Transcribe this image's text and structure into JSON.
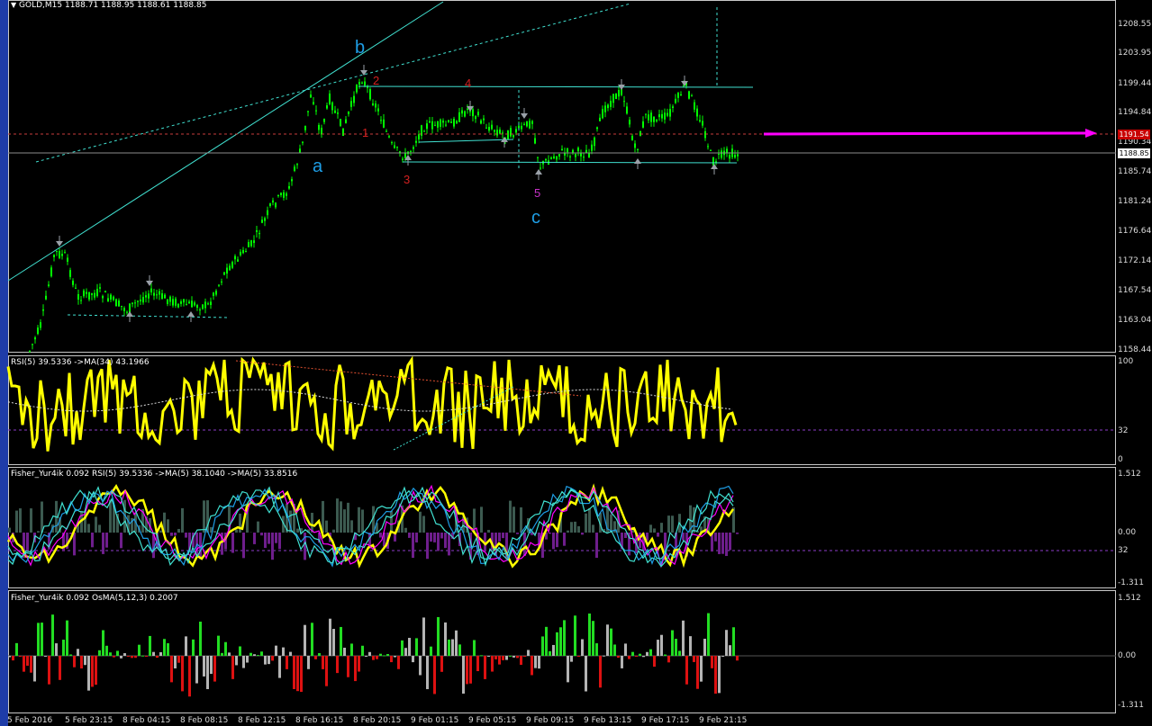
{
  "chart_title": "GOLD,M15  1188.71 1188.95 1188.61 1188.85",
  "main_scale": [
    "1208.55",
    "1203.95",
    "1199.44",
    "1194.84",
    "1190.34",
    "1185.74",
    "1181.24",
    "1176.64",
    "1172.14",
    "1167.54",
    "1163.04",
    "1158.44"
  ],
  "price_badges": {
    "line": "1191.54",
    "current": "1188.85"
  },
  "wave_labels": {
    "b": "b",
    "a": "a",
    "c": "c",
    "n1": "1",
    "n2": "2",
    "n3": "3",
    "n4": "4",
    "n5": "5"
  },
  "rsi_panel": {
    "title": "RSI(5) 39.5336  ->MA(34) 43.1966",
    "scale": [
      "100",
      "32",
      "0"
    ]
  },
  "fisher_panel": {
    "title": "Fisher_Yur4ik 0.092  RSI(5) 39.5336  ->MA(5) 38.1040  ->MA(5) 33.8516",
    "scale": [
      "1.512",
      "0.00",
      "32",
      "-1.311"
    ]
  },
  "osma_panel": {
    "title": "Fisher_Yur4ik 0.092  OsMA(5,12,3) 0.2007",
    "scale": [
      "1.512",
      "0.00",
      "-1.311"
    ]
  },
  "time_axis": [
    "5 Feb 2016",
    "5 Feb 23:15",
    "8 Feb 04:15",
    "8 Feb 08:15",
    "8 Feb 12:15",
    "8 Feb 16:15",
    "8 Feb 20:15",
    "9 Feb 01:15",
    "9 Feb 05:15",
    "9 Feb 09:15",
    "9 Feb 13:15",
    "9 Feb 17:15",
    "9 Feb 21:15"
  ],
  "colors": {
    "candle": "#00ff00",
    "rsi": "#ffff00",
    "trend": "#40e0d0",
    "wave_blue": "#1e9ee6",
    "wave_red": "#d22020",
    "wave_magenta": "#c832c8",
    "arrow": "#ff00ff",
    "hist_green": "#22dd22",
    "hist_red": "#dd1111",
    "hist_gray": "#b4b4b4"
  }
}
